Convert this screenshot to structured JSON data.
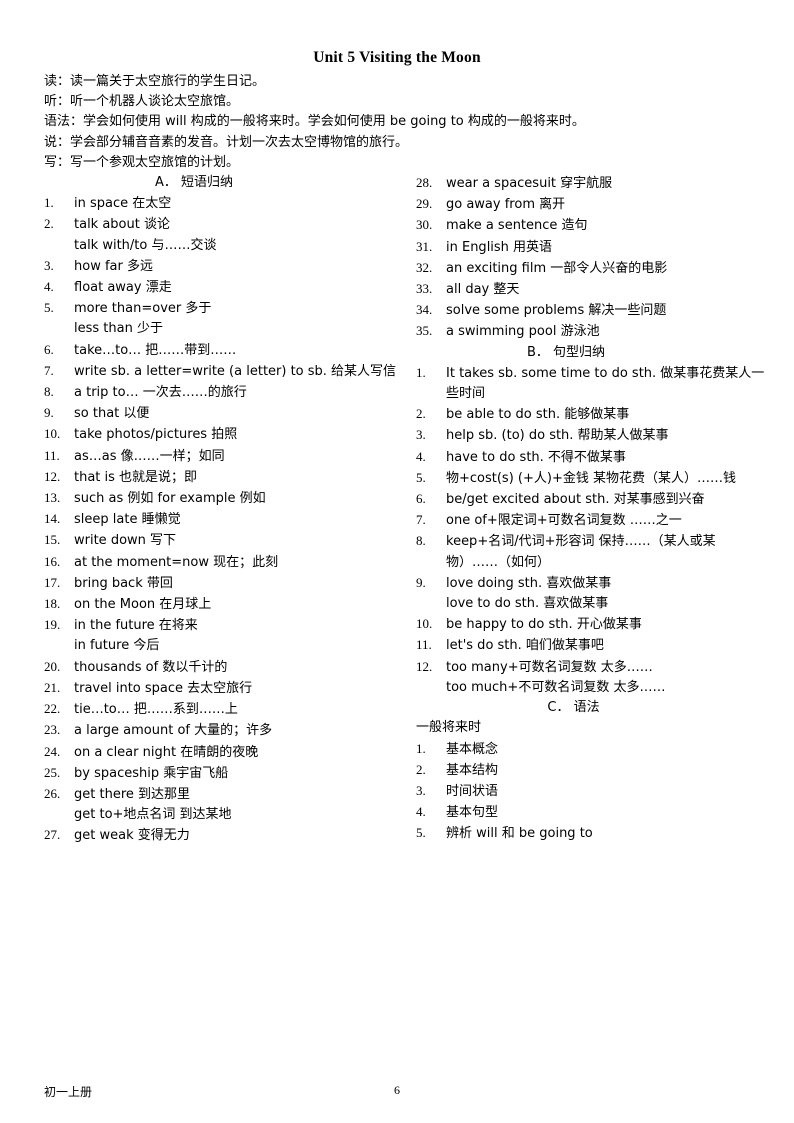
{
  "document": {
    "title": "Unit 5 Visiting the Moon",
    "intro": [
      "读：读一篇关于太空旅行的学生日记。",
      "听：听一个机器人谈论太空旅馆。",
      "语法：学会如何使用 will 构成的一般将来时。学会如何使用 be going to 构成的一般将来时。",
      "说：学会部分辅音音素的发音。计划一次去太空博物馆的旅行。",
      "写：写一个参观太空旅馆的计划。"
    ],
    "sections": {
      "a": {
        "heading": "A． 短语归纳",
        "items": [
          {
            "num": "1.",
            "text": "in space    在太空"
          },
          {
            "num": "2.",
            "text": "talk about    谈论"
          },
          {
            "num": "",
            "text": "talk with/to     与……交谈"
          },
          {
            "num": "3.",
            "text": "how far    多远"
          },
          {
            "num": "4.",
            "text": "float away    漂走"
          },
          {
            "num": "5.",
            "text": "more than=over    多于"
          },
          {
            "num": "",
            "text": "less than    少于"
          },
          {
            "num": "6.",
            "text": "take…to…    把……带到……"
          },
          {
            "num": "7.",
            "text": "write sb. a letter=write (a letter) to sb.    给某人写信"
          },
          {
            "num": "8.",
            "text": "a trip to…    一次去……的旅行"
          },
          {
            "num": "9.",
            "text": "so that    以便"
          },
          {
            "num": "10.",
            "text": "take photos/pictures    拍照"
          },
          {
            "num": "11.",
            "text": "as…as    像……一样；如同"
          },
          {
            "num": "12.",
            "text": "that is    也就是说；即"
          },
          {
            "num": "13.",
            "text": "such as    例如    for example    例如"
          },
          {
            "num": "14.",
            "text": "sleep late    睡懒觉"
          },
          {
            "num": "15.",
            "text": "write down    写下"
          },
          {
            "num": "16.",
            "text": "at the moment=now    现在；此刻"
          },
          {
            "num": "17.",
            "text": "bring back    带回"
          },
          {
            "num": "18.",
            "text": "on the Moon    在月球上"
          },
          {
            "num": "19.",
            "text": "in the future    在将来"
          },
          {
            "num": "",
            "text": "in future    今后"
          },
          {
            "num": "20.",
            "text": "thousands of    数以千计的"
          },
          {
            "num": "21.",
            "text": "travel into space    去太空旅行"
          },
          {
            "num": "22.",
            "text": "tie…to…    把……系到……上"
          },
          {
            "num": "23.",
            "text": "a large amount of    大量的；许多"
          },
          {
            "num": "24.",
            "text": "on a clear night    在晴朗的夜晚"
          },
          {
            "num": "25.",
            "text": "by spaceship    乘宇宙飞船"
          },
          {
            "num": "26.",
            "text": "get there    到达那里"
          },
          {
            "num": "",
            "text": "get to+地点名词     到达某地"
          },
          {
            "num": "27.",
            "text": "get weak    变得无力"
          }
        ],
        "items_right": [
          {
            "num": "28.",
            "text": "wear a spacesuit    穿宇航服"
          },
          {
            "num": "29.",
            "text": "go away from    离开"
          },
          {
            "num": "30.",
            "text": "make a sentence    造句"
          },
          {
            "num": "31.",
            "text": "in English    用英语"
          },
          {
            "num": "32.",
            "text": "an exciting film    一部令人兴奋的电影"
          },
          {
            "num": "33.",
            "text": "all day    整天"
          },
          {
            "num": "34.",
            "text": "solve some problems    解决一些问题"
          },
          {
            "num": "35.",
            "text": "a swimming pool    游泳池"
          }
        ]
      },
      "b": {
        "heading": "B． 句型归纳",
        "items": [
          {
            "num": "1.",
            "text": "It takes sb. some time to do sth.    做某事花费某人一",
            "cont": "些时间"
          },
          {
            "num": "2.",
            "text": "be able to do sth.    能够做某事"
          },
          {
            "num": "3.",
            "text": "help sb. (to) do sth.    帮助某人做某事"
          },
          {
            "num": "4.",
            "text": "have to do sth.    不得不做某事"
          },
          {
            "num": "5.",
            "text": "物+cost(s) (+人)+金钱     某物花费（某人）……钱"
          },
          {
            "num": "6.",
            "text": "be/get excited about sth.    对某事感到兴奋"
          },
          {
            "num": "7.",
            "text": "one of+限定词+可数名词复数     ……之一"
          },
          {
            "num": "8.",
            "text": "keep+名词/代词+形容词     保持……（某人或某",
            "cont": "物）……（如何）"
          },
          {
            "num": "9.",
            "text": "love doing sth.     喜欢做某事"
          },
          {
            "num": "",
            "text": "love to do sth.     喜欢做某事"
          },
          {
            "num": "10.",
            "text": "be happy to do sth.     开心做某事"
          },
          {
            "num": "11.",
            "text": "let's do sth.     咱们做某事吧"
          },
          {
            "num": "12.",
            "text": "too many+可数名词复数     太多……"
          },
          {
            "num": "",
            "text": "too much+不可数名词复数     太多……"
          }
        ]
      },
      "c": {
        "heading": "C． 语法",
        "lead": "一般将来时",
        "items": [
          {
            "num": "1.",
            "text": "基本概念"
          },
          {
            "num": "2.",
            "text": "基本结构"
          },
          {
            "num": "3.",
            "text": "时间状语"
          },
          {
            "num": "4.",
            "text": "基本句型"
          },
          {
            "num": "5.",
            "text": "辨析 will 和 be going to"
          }
        ]
      }
    }
  },
  "footer": {
    "left": "初一上册",
    "page": "6"
  }
}
